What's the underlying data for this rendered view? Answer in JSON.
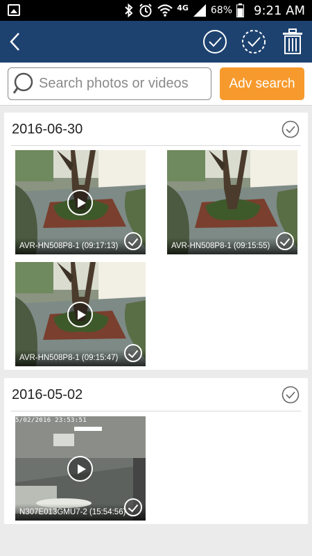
{
  "status_bar": {
    "battery_percent": "68%",
    "time": "9:21 AM",
    "network": "4G",
    "icons": [
      "image-icon",
      "bluetooth-icon",
      "alarm-icon",
      "wifi-icon",
      "signal-icon",
      "battery-icon"
    ]
  },
  "action_bar": {
    "icons": [
      "back-icon",
      "select-all-check-icon",
      "select-dashed-check-icon",
      "trash-icon"
    ],
    "colors": {
      "background": "#1d4270",
      "icon": "#ffffff"
    }
  },
  "search": {
    "placeholder": "Search photos or videos",
    "value": "",
    "adv_button_label": "Adv search",
    "adv_button_color": "#f79a2d"
  },
  "groups": [
    {
      "date": "2016-06-30",
      "items": [
        {
          "label": "AVR-HN508P8-1 (09:17:13)",
          "type": "video",
          "scene": "garden"
        },
        {
          "label": "AVR-HN508P8-1 (09:15:55)",
          "type": "video",
          "scene": "garden"
        },
        {
          "label": "AVR-HN508P8-1 (09:15:47)",
          "type": "video",
          "scene": "garden"
        }
      ]
    },
    {
      "date": "2016-05-02",
      "items": [
        {
          "label": "N307E013GMU7-2 (15:54:56)",
          "type": "video",
          "scene": "indoor",
          "osd_text": "5/02/2016 23:53:51"
        }
      ]
    }
  ]
}
